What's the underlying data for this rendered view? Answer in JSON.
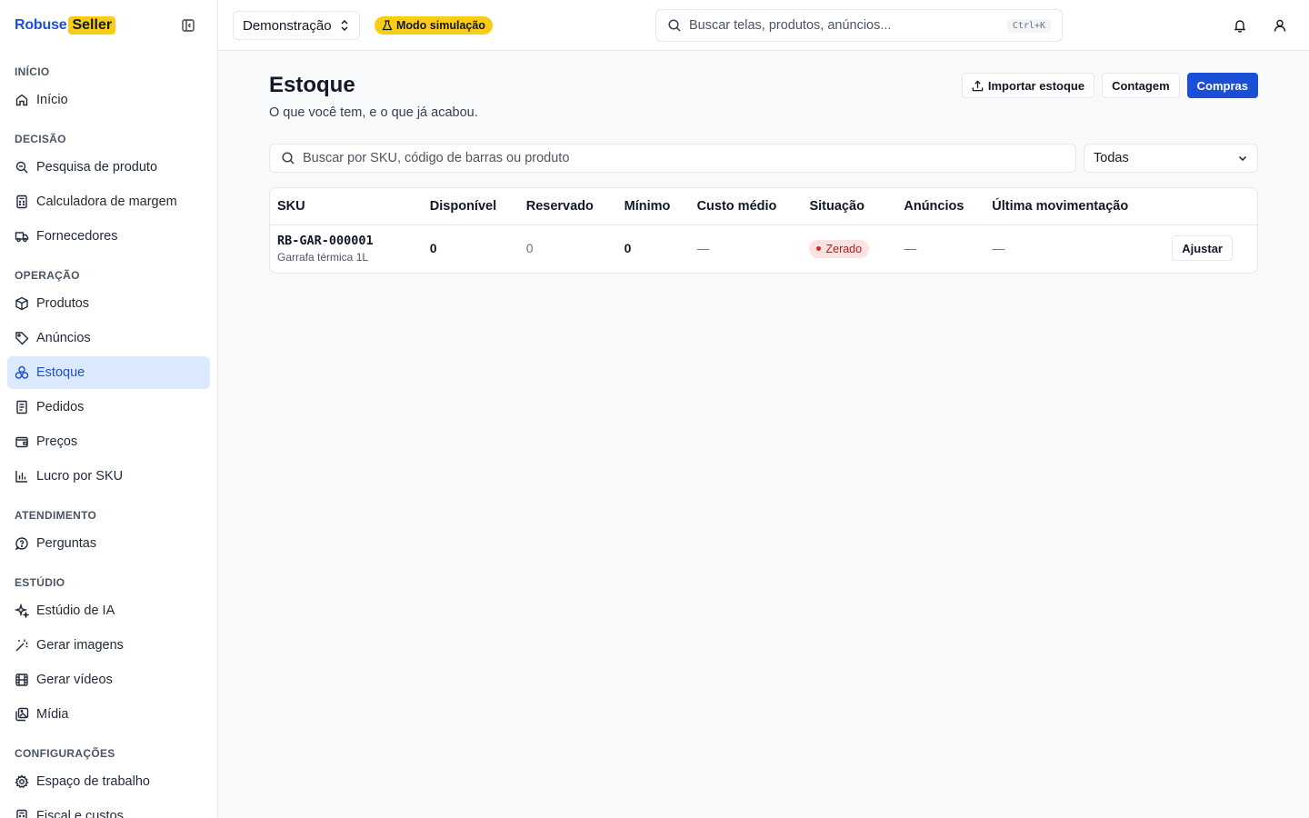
{
  "brand": {
    "part1": "Robuse",
    "part2": "Seller"
  },
  "sidebar": {
    "sections": [
      {
        "title": "INÍCIO",
        "items": [
          {
            "label": "Início",
            "icon": "home-icon"
          }
        ]
      },
      {
        "title": "DECISÃO",
        "items": [
          {
            "label": "Pesquisa de produto",
            "icon": "search-zoom-icon"
          },
          {
            "label": "Calculadora de margem",
            "icon": "calculator-icon"
          },
          {
            "label": "Fornecedores",
            "icon": "truck-icon"
          }
        ]
      },
      {
        "title": "OPERAÇÃO",
        "items": [
          {
            "label": "Produtos",
            "icon": "box-icon"
          },
          {
            "label": "Anúncios",
            "icon": "tag-icon"
          },
          {
            "label": "Estoque",
            "icon": "boxes-icon",
            "active": true
          },
          {
            "label": "Pedidos",
            "icon": "receipt-icon"
          },
          {
            "label": "Preços",
            "icon": "wallet-icon"
          },
          {
            "label": "Lucro por SKU",
            "icon": "bar-chart-icon"
          }
        ]
      },
      {
        "title": "ATENDIMENTO",
        "items": [
          {
            "label": "Perguntas",
            "icon": "question-bubble-icon"
          }
        ]
      },
      {
        "title": "ESTÚDIO",
        "items": [
          {
            "label": "Estúdio de IA",
            "icon": "sparkles-icon"
          },
          {
            "label": "Gerar imagens",
            "icon": "magic-wand-icon"
          },
          {
            "label": "Gerar vídeos",
            "icon": "film-icon"
          },
          {
            "label": "Mídia",
            "icon": "images-icon"
          }
        ]
      },
      {
        "title": "CONFIGURAÇÕES",
        "items": [
          {
            "label": "Espaço de trabalho",
            "icon": "gear-icon"
          },
          {
            "label": "Fiscal e custos",
            "icon": "calculator-icon"
          }
        ]
      }
    ]
  },
  "topbar": {
    "workspace": "Demonstração",
    "sim_badge": "Modo simulação",
    "search_placeholder": "Buscar telas, produtos, anúncios...",
    "shortcut": "Ctrl+K"
  },
  "page": {
    "title": "Estoque",
    "subtitle": "O que você tem, e o que já acabou.",
    "actions": {
      "import": "Importar estoque",
      "count": "Contagem",
      "purchases": "Compras"
    },
    "search_placeholder": "Buscar por SKU, código de barras ou produto",
    "status_filter": "Todas"
  },
  "table": {
    "columns": [
      "SKU",
      "Disponível",
      "Reservado",
      "Mínimo",
      "Custo médio",
      "Situação",
      "Anúncios",
      "Última movimentação"
    ],
    "rows": [
      {
        "sku": "RB-GAR-000001",
        "name": "Garrafa térmica 1L",
        "available": "0",
        "reserved": "0",
        "minimum": "0",
        "avg_cost": "—",
        "status": "Zerado",
        "listings": "—",
        "last_move": "—",
        "action": "Ajustar"
      }
    ]
  }
}
